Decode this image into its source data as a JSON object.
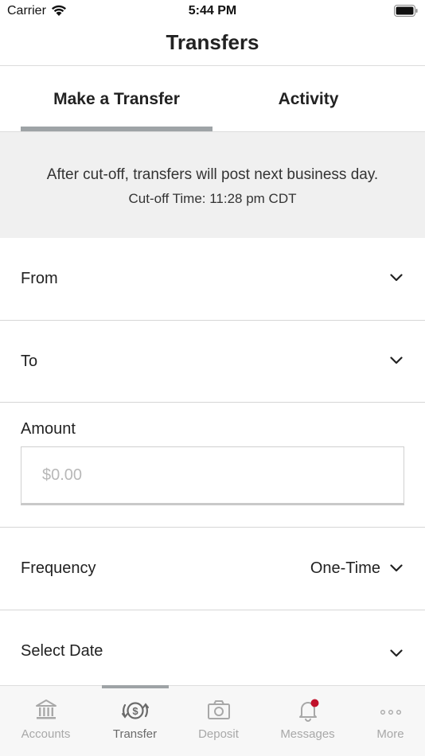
{
  "status_bar": {
    "carrier": "Carrier",
    "time": "5:44 PM"
  },
  "header": {
    "title": "Transfers"
  },
  "tabs": [
    {
      "label": "Make a Transfer",
      "selected": true
    },
    {
      "label": "Activity",
      "selected": false
    }
  ],
  "notice": {
    "message": "After cut-off, transfers will post next business day.",
    "cutoff": "Cut-off Time: 11:28 pm CDT"
  },
  "form": {
    "from_label": "From",
    "to_label": "To",
    "amount_label": "Amount",
    "amount_value": "",
    "amount_placeholder": "$0.00",
    "frequency_label": "Frequency",
    "frequency_value": "One-Time",
    "date_label": "Select Date"
  },
  "tab_bar": {
    "items": [
      {
        "label": "Accounts",
        "icon": "bank-icon",
        "active": false
      },
      {
        "label": "Transfer",
        "icon": "transfer-dollar-icon",
        "active": true
      },
      {
        "label": "Deposit",
        "icon": "camera-icon",
        "active": false
      },
      {
        "label": "Messages",
        "icon": "bell-icon",
        "active": false,
        "badge": true
      },
      {
        "label": "More",
        "icon": "more-dots-icon",
        "active": false
      }
    ]
  },
  "colors": {
    "accent_gray": "#9ea3a6",
    "notification_badge": "#c0102a",
    "notice_background": "#f0f0f0"
  }
}
